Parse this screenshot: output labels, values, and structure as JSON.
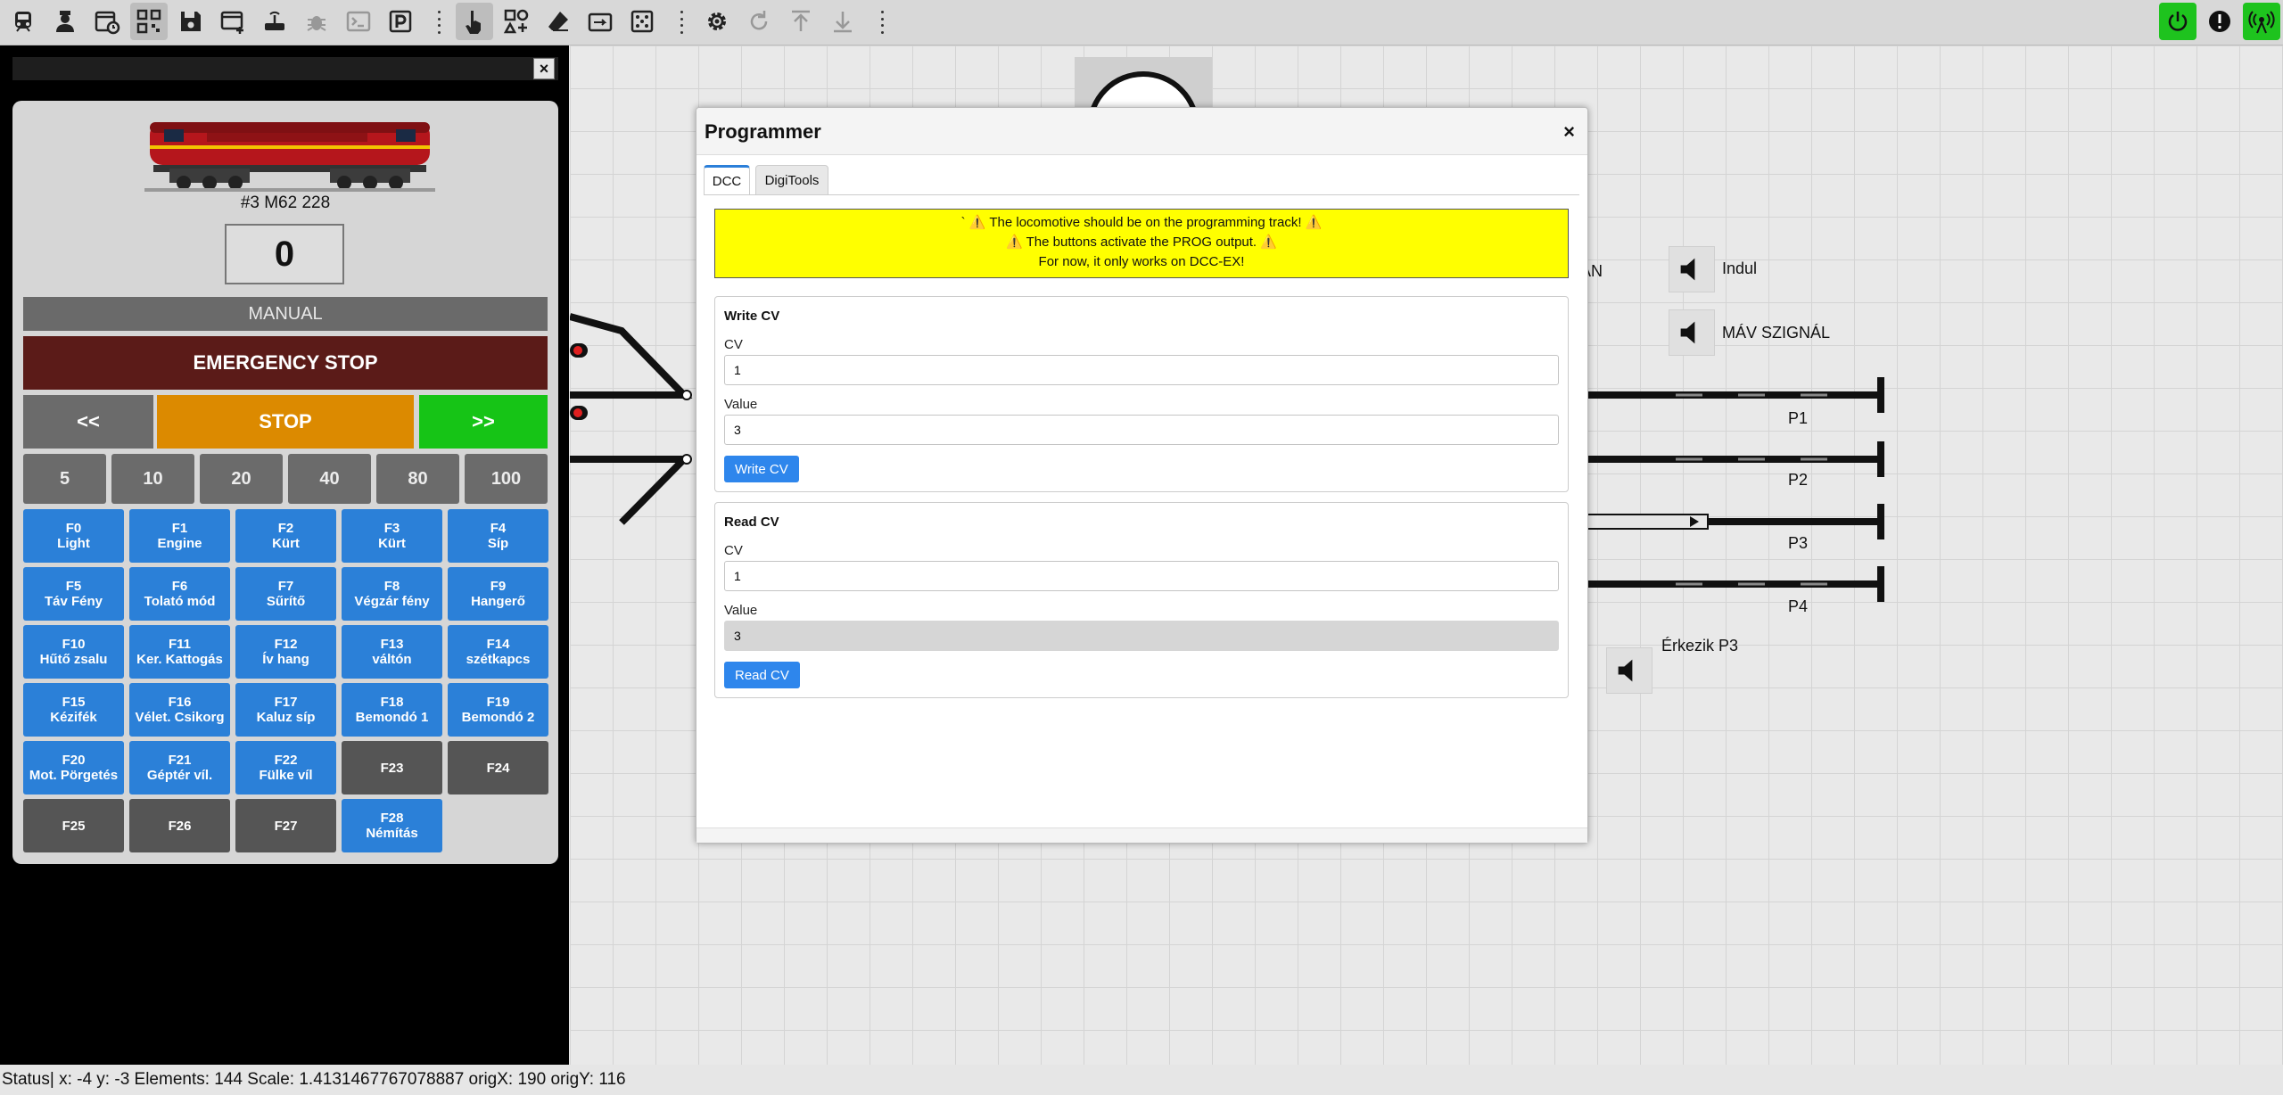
{
  "toolbar": {
    "left_icons": [
      "train-icon",
      "user-icon",
      "calendar-clock-icon",
      "qr-code-icon",
      "save-icon",
      "window-add-icon",
      "router-icon",
      "bug-icon",
      "terminal-icon",
      "parking-icon",
      "hand-pointer-icon",
      "shapes-add-icon",
      "eraser-icon",
      "route-icon",
      "map-marker-icon",
      "gear-icon",
      "redo-icon",
      "upload-icon",
      "download-icon"
    ],
    "right_icons": [
      "power-icon",
      "alert-icon",
      "broadcast-icon"
    ]
  },
  "loco": {
    "name": "#3 M62 228",
    "speed": "0",
    "mode": "MANUAL",
    "emergency": "EMERGENCY STOP",
    "rev": "<<",
    "stop": "STOP",
    "fwd": ">>",
    "steps": [
      "5",
      "10",
      "20",
      "40",
      "80",
      "100"
    ],
    "functions": [
      {
        "key": "F0",
        "label": "Light",
        "on": true
      },
      {
        "key": "F1",
        "label": "Engine",
        "on": true
      },
      {
        "key": "F2",
        "label": "Kürt",
        "on": true
      },
      {
        "key": "F3",
        "label": "Kürt",
        "on": true
      },
      {
        "key": "F4",
        "label": "Síp",
        "on": true
      },
      {
        "key": "F5",
        "label": "Táv Fény",
        "on": true
      },
      {
        "key": "F6",
        "label": "Tolató mód",
        "on": true
      },
      {
        "key": "F7",
        "label": "Sűrítő",
        "on": true
      },
      {
        "key": "F8",
        "label": "Végzár fény",
        "on": true
      },
      {
        "key": "F9",
        "label": "Hangerő",
        "on": true
      },
      {
        "key": "F10",
        "label": "Hűtő zsalu",
        "on": true
      },
      {
        "key": "F11",
        "label": "Ker. Kattogás",
        "on": true
      },
      {
        "key": "F12",
        "label": "Ív hang",
        "on": true
      },
      {
        "key": "F13",
        "label": "váltón",
        "on": true
      },
      {
        "key": "F14",
        "label": "szétkapcs",
        "on": true
      },
      {
        "key": "F15",
        "label": "Kézifék",
        "on": true
      },
      {
        "key": "F16",
        "label": "Vélet. Csikorg",
        "on": true
      },
      {
        "key": "F17",
        "label": "Kaluz síp",
        "on": true
      },
      {
        "key": "F18",
        "label": "Bemondó 1",
        "on": true
      },
      {
        "key": "F19",
        "label": "Bemondó 2",
        "on": true
      },
      {
        "key": "F20",
        "label": "Mot. Pörgetés",
        "on": true
      },
      {
        "key": "F21",
        "label": "Géptér víl.",
        "on": true
      },
      {
        "key": "F22",
        "label": "Fülke víl",
        "on": true
      },
      {
        "key": "F23",
        "label": "",
        "on": false
      },
      {
        "key": "F24",
        "label": "",
        "on": false
      },
      {
        "key": "F25",
        "label": "",
        "on": false
      },
      {
        "key": "F26",
        "label": "",
        "on": false
      },
      {
        "key": "F27",
        "label": "",
        "on": false
      },
      {
        "key": "F28",
        "label": "Némítás",
        "on": true
      }
    ]
  },
  "canvas": {
    "partial_label": "ÁN",
    "tracks": [
      "P1",
      "P2",
      "P3",
      "P4"
    ],
    "speakers": [
      "Indul",
      "MÁV SZIGNÁL",
      "Érkezik P3"
    ]
  },
  "modal": {
    "title": "Programmer",
    "close": "×",
    "tabs": [
      "DCC",
      "DigiTools"
    ],
    "warning": [
      "` ⚠️ The locomotive should be on the programming track! ⚠️",
      "⚠️ The buttons activate the PROG output. ⚠️",
      "For now, it only works on DCC-EX!"
    ],
    "write": {
      "title": "Write CV",
      "cv_label": "CV",
      "cv": "1",
      "value_label": "Value",
      "value": "3",
      "button": "Write CV"
    },
    "read": {
      "title": "Read CV",
      "cv_label": "CV",
      "cv": "1",
      "value_label": "Value",
      "value": "3",
      "button": "Read CV"
    }
  },
  "status": "Status| x: -4 y: -3 Elements: 144 Scale: 1.4131467767078887 origX: 190 origY: 116",
  "colors": {
    "accent": "#2b80d8",
    "emergency": "#5b1b18",
    "stop": "#dc8a00",
    "forward": "#16c416",
    "warning": "#ffff00"
  }
}
